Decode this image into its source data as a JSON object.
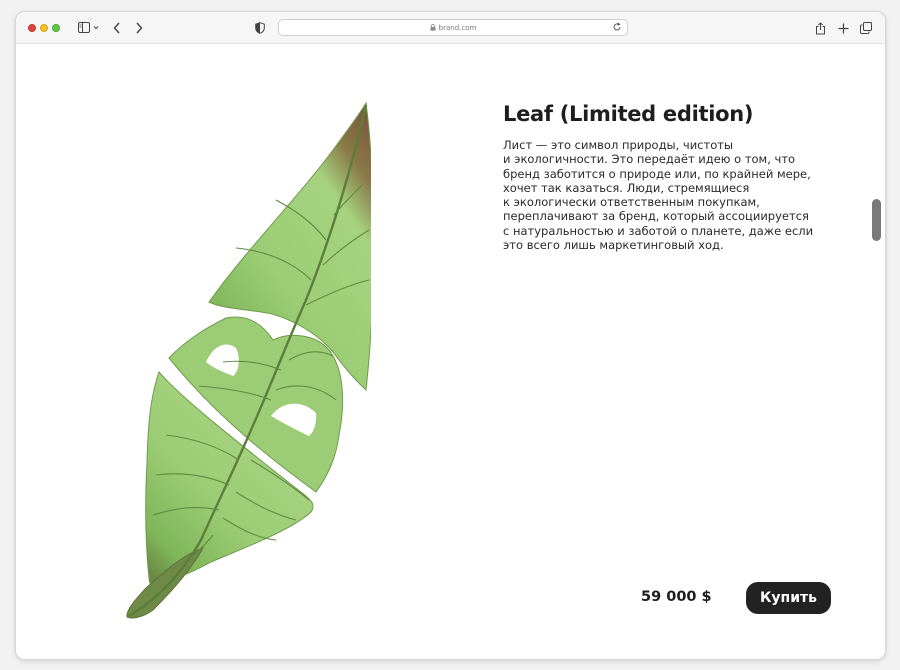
{
  "browser": {
    "url": "brand.com",
    "icons": {
      "sidebar": "sidebar-icon",
      "back": "chevron-left-icon",
      "forward": "chevron-right-icon",
      "privacy": "shield-icon",
      "lock": "lock-icon",
      "reload": "reload-icon",
      "share": "share-icon",
      "new_tab": "plus-icon",
      "tabs": "tabs-overview-icon"
    }
  },
  "product": {
    "title": "Leaf (Limited edition)",
    "description": "Лист — это символ природы, чистоты\nи экологичности. Это передаёт идею о том, что\nбренд заботится о природе или, по крайней мере,\nхочет так казаться. Люди, стремящиеся\nк экологически ответственным покупкам,\nпереплачивают за бренд, который ассоциируется\nс натуральностью и заботой о планете, даже если\nэто всего лишь маркетинговый ход.",
    "price": "59 000 $",
    "buy_label": "Купить"
  },
  "colors": {
    "leaf_light": "#9fd07a",
    "leaf_dark": "#6da84e",
    "leaf_tip": "#7c5a3e",
    "button_bg": "#222222",
    "button_text": "#ffffff"
  }
}
